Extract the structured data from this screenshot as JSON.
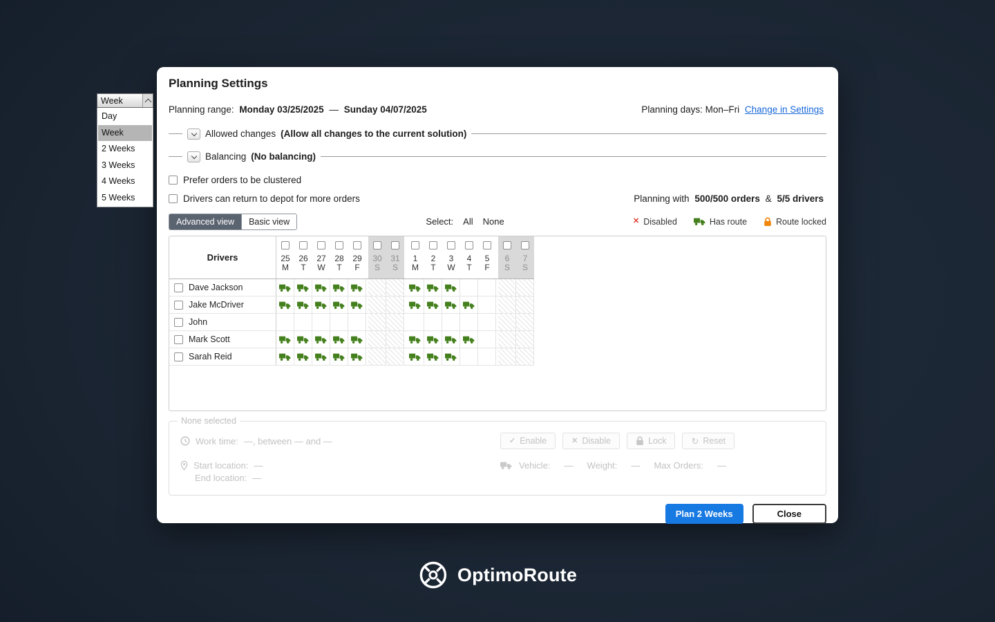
{
  "dropdown": {
    "selected": "Week",
    "options": [
      "Day",
      "Week",
      "2 Weeks",
      "3 Weeks",
      "4 Weeks",
      "5 Weeks"
    ],
    "highlighted": "Week"
  },
  "modal": {
    "title": "Planning Settings",
    "range": {
      "label": "Planning range:",
      "start": "Monday 03/25/2025",
      "dash": "—",
      "end": "Sunday 04/07/2025"
    },
    "days": {
      "text": "Planning days: Mon–Fri",
      "link": "Change in Settings"
    },
    "allowed_changes": {
      "label": "Allowed changes",
      "value": "(Allow all changes to the current solution)"
    },
    "balancing": {
      "label": "Balancing",
      "value": "(No balancing)"
    },
    "options": {
      "cluster": "Prefer orders to be clustered",
      "return_depot": "Drivers can return to depot for more orders"
    },
    "planning_with": {
      "prefix": "Planning with",
      "orders": "500/500 orders",
      "amp": "&",
      "drivers": "5/5 drivers"
    },
    "view_tabs": [
      {
        "label": "Advanced view",
        "active": true
      },
      {
        "label": "Basic view",
        "active": false
      }
    ],
    "select": {
      "label": "Select:",
      "all": "All",
      "none": "None"
    },
    "legend": [
      {
        "icon": "x-icon",
        "label": "Disabled"
      },
      {
        "icon": "truck-icon",
        "label": "Has route"
      },
      {
        "icon": "lock-icon",
        "label": "Route locked"
      }
    ],
    "calendar": {
      "drivers_header": "Drivers",
      "columns": [
        {
          "day": "25",
          "dow": "M",
          "weekend": false,
          "gap_before": false
        },
        {
          "day": "26",
          "dow": "T",
          "weekend": false,
          "gap_before": false
        },
        {
          "day": "27",
          "dow": "W",
          "weekend": false,
          "gap_before": false
        },
        {
          "day": "28",
          "dow": "T",
          "weekend": false,
          "gap_before": false
        },
        {
          "day": "29",
          "dow": "F",
          "weekend": false,
          "gap_before": false
        },
        {
          "day": "30",
          "dow": "S",
          "weekend": true,
          "gap_before": true
        },
        {
          "day": "31",
          "dow": "S",
          "weekend": true,
          "gap_before": false
        },
        {
          "day": "1",
          "dow": "M",
          "weekend": false,
          "gap_before": true
        },
        {
          "day": "2",
          "dow": "T",
          "weekend": false,
          "gap_before": false
        },
        {
          "day": "3",
          "dow": "W",
          "weekend": false,
          "gap_before": false
        },
        {
          "day": "4",
          "dow": "T",
          "weekend": false,
          "gap_before": false
        },
        {
          "day": "5",
          "dow": "F",
          "weekend": false,
          "gap_before": false
        },
        {
          "day": "6",
          "dow": "S",
          "weekend": true,
          "gap_before": true
        },
        {
          "day": "7",
          "dow": "S",
          "weekend": true,
          "gap_before": false
        }
      ],
      "rows": [
        {
          "name": "Dave Jackson",
          "routes": [
            1,
            1,
            1,
            1,
            1,
            0,
            0,
            1,
            1,
            1,
            0,
            0,
            0,
            0
          ]
        },
        {
          "name": "Jake McDriver",
          "routes": [
            1,
            1,
            1,
            1,
            1,
            0,
            0,
            1,
            1,
            1,
            1,
            0,
            0,
            0
          ]
        },
        {
          "name": "John",
          "routes": [
            0,
            0,
            0,
            0,
            0,
            0,
            0,
            0,
            0,
            0,
            0,
            0,
            0,
            0
          ]
        },
        {
          "name": "Mark Scott",
          "routes": [
            1,
            1,
            1,
            1,
            1,
            0,
            0,
            1,
            1,
            1,
            1,
            0,
            0,
            0
          ]
        },
        {
          "name": "Sarah Reid",
          "routes": [
            1,
            1,
            1,
            1,
            1,
            0,
            0,
            1,
            1,
            1,
            0,
            0,
            0,
            0
          ]
        }
      ]
    },
    "details": {
      "legend": "None selected",
      "work_time_label": "Work time:",
      "work_time_value": "—, between — and —",
      "actions": [
        {
          "icon": "check-icon",
          "label": "Enable"
        },
        {
          "icon": "x-icon",
          "label": "Disable"
        },
        {
          "icon": "lock-icon",
          "label": "Lock"
        },
        {
          "icon": "reset-icon",
          "label": "Reset"
        }
      ],
      "start_location_label": "Start location:",
      "start_location_value": "—",
      "end_location_label": "End location:",
      "end_location_value": "—",
      "vehicle_label": "Vehicle:",
      "vehicle_value": "—",
      "weight_label": "Weight:",
      "weight_value": "—",
      "max_orders_label": "Max Orders:",
      "max_orders_value": "—"
    },
    "footer": {
      "plan": "Plan 2 Weeks",
      "close": "Close"
    }
  },
  "logo": {
    "text": "OptimoRoute"
  },
  "colors": {
    "truck_green": "#45801e",
    "lock_orange": "#f0860a",
    "disabled_red": "#e03a2f",
    "accent_blue": "#1779e2"
  }
}
